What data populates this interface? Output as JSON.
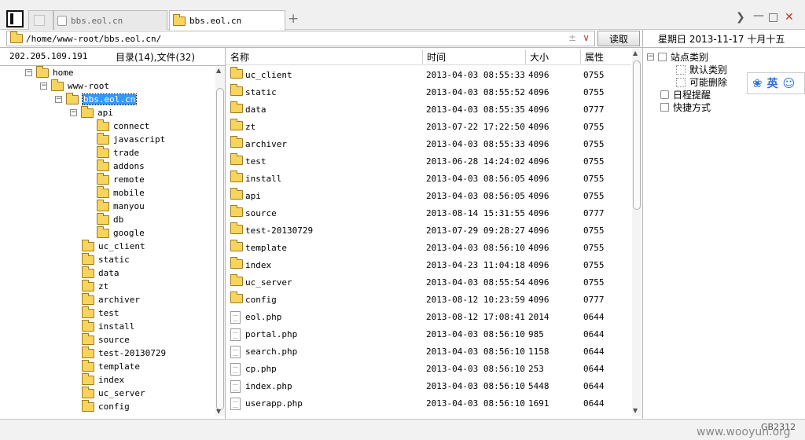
{
  "tabs": [
    {
      "label": ""
    },
    {
      "label": "bbs.eol.cn"
    },
    {
      "label": "bbs.eol.cn"
    }
  ],
  "address": {
    "path": "/home/www-root/bbs.eol.cn/",
    "read_label": "读取"
  },
  "date": "星期日 2013-11-17 十月十五",
  "left_info": {
    "ip": "202.205.109.191",
    "counts": "目录(14),文件(32)"
  },
  "tree": [
    {
      "label": "home",
      "toggle": "−"
    },
    {
      "label": "www-root",
      "toggle": "−"
    },
    {
      "label": "bbs.eol.cn",
      "toggle": "−"
    },
    {
      "label": "api",
      "toggle": "−"
    },
    {
      "label": "connect"
    },
    {
      "label": "javascript"
    },
    {
      "label": "trade"
    },
    {
      "label": "addons"
    },
    {
      "label": "remote"
    },
    {
      "label": "mobile"
    },
    {
      "label": "manyou"
    },
    {
      "label": "db"
    },
    {
      "label": "google"
    },
    {
      "label": "uc_client"
    },
    {
      "label": "static"
    },
    {
      "label": "data"
    },
    {
      "label": "zt"
    },
    {
      "label": "archiver"
    },
    {
      "label": "test"
    },
    {
      "label": "install"
    },
    {
      "label": "source"
    },
    {
      "label": "test-20130729"
    },
    {
      "label": "template"
    },
    {
      "label": "index"
    },
    {
      "label": "uc_server"
    },
    {
      "label": "config"
    }
  ],
  "columns": {
    "name": "名称",
    "time": "时间",
    "size": "大小",
    "attr": "属性"
  },
  "files": [
    {
      "name": "uc_client",
      "time": "2013-04-03 08:55:33",
      "size": "4096",
      "attr": "0755",
      "type": "folder"
    },
    {
      "name": "static",
      "time": "2013-04-03 08:55:52",
      "size": "4096",
      "attr": "0755",
      "type": "folder"
    },
    {
      "name": "data",
      "time": "2013-04-03 08:55:35",
      "size": "4096",
      "attr": "0777",
      "type": "folder"
    },
    {
      "name": "zt",
      "time": "2013-07-22 17:22:50",
      "size": "4096",
      "attr": "0755",
      "type": "folder"
    },
    {
      "name": "archiver",
      "time": "2013-04-03 08:55:33",
      "size": "4096",
      "attr": "0755",
      "type": "folder"
    },
    {
      "name": "test",
      "time": "2013-06-28 14:24:02",
      "size": "4096",
      "attr": "0755",
      "type": "folder"
    },
    {
      "name": "install",
      "time": "2013-04-03 08:56:05",
      "size": "4096",
      "attr": "0755",
      "type": "folder"
    },
    {
      "name": "api",
      "time": "2013-04-03 08:56:05",
      "size": "4096",
      "attr": "0755",
      "type": "folder"
    },
    {
      "name": "source",
      "time": "2013-08-14 15:31:55",
      "size": "4096",
      "attr": "0777",
      "type": "folder"
    },
    {
      "name": "test-20130729",
      "time": "2013-07-29 09:28:27",
      "size": "4096",
      "attr": "0755",
      "type": "folder"
    },
    {
      "name": "template",
      "time": "2013-04-03 08:56:10",
      "size": "4096",
      "attr": "0755",
      "type": "folder"
    },
    {
      "name": "index",
      "time": "2013-04-23 11:04:18",
      "size": "4096",
      "attr": "0755",
      "type": "folder"
    },
    {
      "name": "uc_server",
      "time": "2013-04-03 08:55:54",
      "size": "4096",
      "attr": "0755",
      "type": "folder"
    },
    {
      "name": "config",
      "time": "2013-08-12 10:23:59",
      "size": "4096",
      "attr": "0777",
      "type": "folder"
    },
    {
      "name": "eol.php",
      "time": "2013-08-12 17:08:41",
      "size": "2014",
      "attr": "0644",
      "type": "file"
    },
    {
      "name": "portal.php",
      "time": "2013-04-03 08:56:10",
      "size": "985",
      "attr": "0644",
      "type": "file"
    },
    {
      "name": "search.php",
      "time": "2013-04-03 08:56:10",
      "size": "1158",
      "attr": "0644",
      "type": "file"
    },
    {
      "name": "cp.php",
      "time": "2013-04-03 08:56:10",
      "size": "253",
      "attr": "0644",
      "type": "file"
    },
    {
      "name": "index.php",
      "time": "2013-04-03 08:56:10",
      "size": "5448",
      "attr": "0644",
      "type": "file"
    },
    {
      "name": "userapp.php",
      "time": "2013-04-03 08:56:10",
      "size": "1691",
      "attr": "0644",
      "type": "file"
    }
  ],
  "right_panel": {
    "site_category": "站点类别",
    "default_category": "默认类别",
    "may_delete": "可能删除",
    "schedule": "日程提醒",
    "shortcuts": "快捷方式"
  },
  "ime": {
    "lang": "英"
  },
  "encoding": "GB2312",
  "watermark": "www.wooyun.org"
}
